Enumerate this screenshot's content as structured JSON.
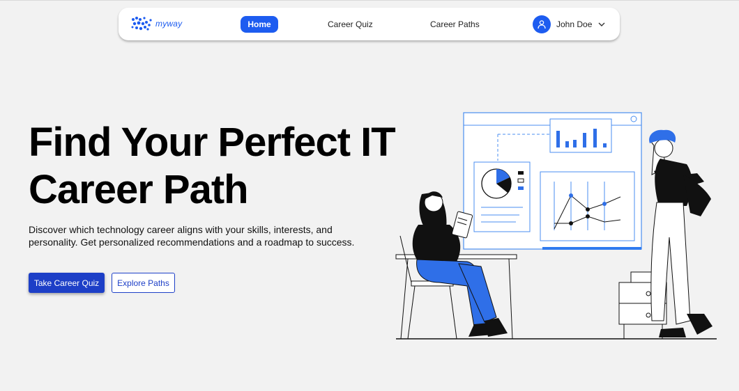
{
  "nav": {
    "logo_text": "myway",
    "links": [
      {
        "label": "Home",
        "active": true
      },
      {
        "label": "Career Quiz",
        "active": false
      },
      {
        "label": "Career Paths",
        "active": false
      }
    ],
    "user_name": "John Doe",
    "user_icon": "user-icon",
    "dropdown_icon": "chevron-down-icon"
  },
  "hero": {
    "title": "Find Your Perfect IT Career Path",
    "subtitle": "Discover which technology career aligns with your skills, interests, and personality. Get personalized recommendations and a roadmap to success.",
    "primary_button": "Take Career Quiz",
    "secondary_button": "Explore Paths"
  },
  "colors": {
    "accent": "#1d5cf0",
    "button_primary": "#1d3fc7",
    "background": "#f2f2f2"
  }
}
